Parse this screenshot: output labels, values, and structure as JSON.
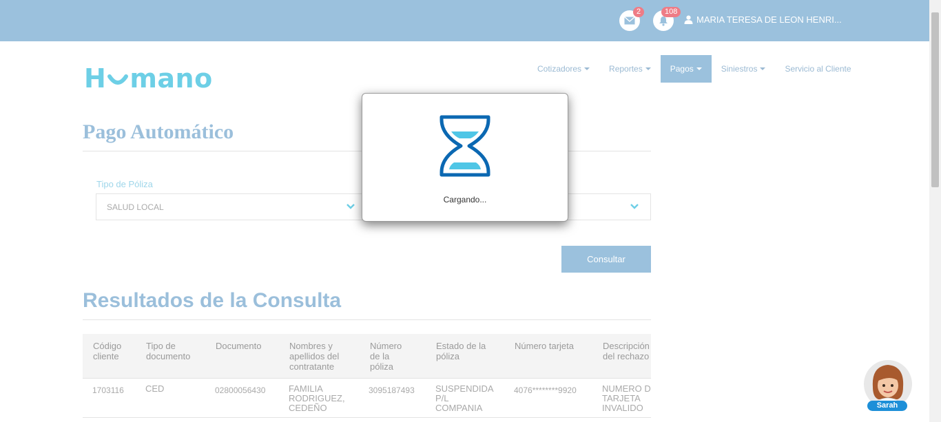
{
  "header": {
    "mail_count": "2",
    "notification_count": "108",
    "user_name": "MARIA TERESA DE LEON HENRI...",
    "mail_icon": "envelope-icon",
    "notification_icon": "bell-icon",
    "user_icon": "user-icon"
  },
  "brand": {
    "logo_text": "Humano"
  },
  "nav": {
    "items": [
      {
        "label": "Cotizadores",
        "has_dropdown": true
      },
      {
        "label": "Reportes",
        "has_dropdown": true
      },
      {
        "label": "Pagos",
        "has_dropdown": true,
        "active": true
      },
      {
        "label": "Siniestros",
        "has_dropdown": true
      },
      {
        "label": "Servicio al Cliente",
        "has_dropdown": false
      }
    ]
  },
  "page": {
    "title": "Pago Automático",
    "policy_type_label": "Tipo de Póliza",
    "policy_type_value": "SALUD LOCAL",
    "consult_button": "Consultar",
    "results_title": "Resultados de la Consulta"
  },
  "table": {
    "headers": [
      "Código cliente",
      "Tipo de documento",
      "Documento",
      "Nombres y apellidos del contratante",
      "Número de la póliza",
      "Estado de la póliza",
      "Número tarjeta",
      "Descripción del rechazo"
    ],
    "rows": [
      [
        "1703116",
        "CED",
        "02800056430",
        "FAMILIA RODRIGUEZ, CEDEÑO",
        "3095187493",
        "SUSPENDIDA P/L COMPANIA",
        "4076********9920",
        "NUMERO DE TARJETA INVALIDO"
      ]
    ]
  },
  "modal": {
    "loading_text": "Cargando...",
    "icon": "hourglass-icon"
  },
  "assistant": {
    "name": "Sarah"
  },
  "colors": {
    "topbar": "#9bc1dd",
    "accent": "#6dcfe6",
    "badge": "#ee7c86",
    "hourglass_frame": "#0b68b2",
    "hourglass_sand": "#4fc6e6"
  }
}
